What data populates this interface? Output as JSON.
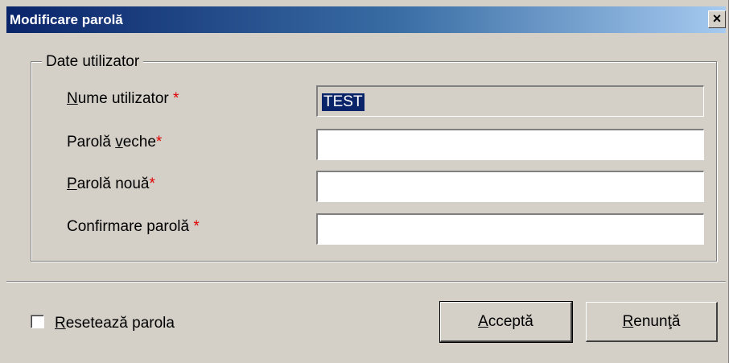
{
  "window": {
    "title": "Modificare parolă",
    "close_glyph": "×"
  },
  "group": {
    "legend": "Date utilizator"
  },
  "fields": {
    "username": {
      "label_u": "N",
      "label_rest": "ume utilizator",
      "star": " *",
      "value": "TEST"
    },
    "old_password": {
      "label_pre": "Parolă ",
      "label_u": "v",
      "label_rest": "eche",
      "star": "*"
    },
    "new_password": {
      "label_u": "P",
      "label_rest": "arolă nouă",
      "star": "*"
    },
    "confirm_password": {
      "label": "Confirmare parolă",
      "star": " *"
    }
  },
  "reset": {
    "label_u": "R",
    "label_rest": "esetează parola",
    "checked": false
  },
  "buttons": {
    "accept": {
      "label_u": "A",
      "label_rest": "cceptă"
    },
    "cancel": {
      "label_u": "R",
      "label_rest": "enunţă"
    }
  },
  "colors": {
    "title_gradient_start": "#0a246a",
    "title_gradient_end": "#a6caf0",
    "required_star": "#e00000",
    "selection": "#0a246a",
    "dialog_bg": "#d4d0c8"
  },
  "icons": {
    "close": "close-icon",
    "checkbox": "checkbox-icon"
  }
}
